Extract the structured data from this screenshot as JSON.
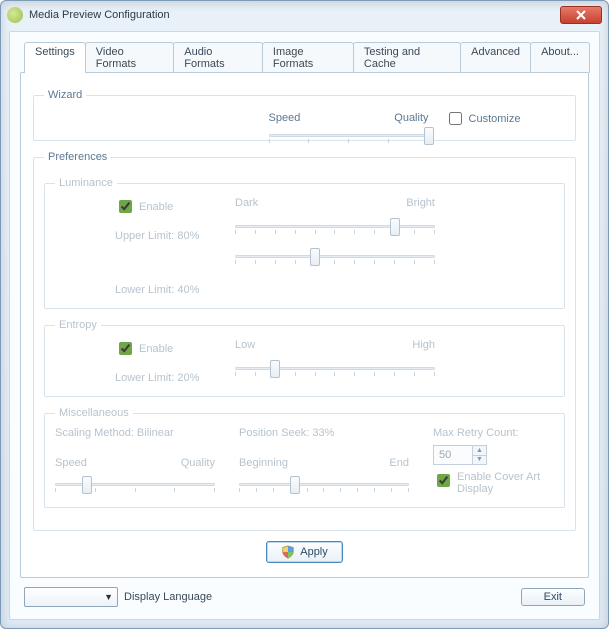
{
  "window": {
    "title": "Media Preview Configuration"
  },
  "tabs": [
    "Settings",
    "Video Formats",
    "Audio Formats",
    "Image Formats",
    "Testing and Cache",
    "Advanced",
    "About..."
  ],
  "active_tab": 0,
  "wizard": {
    "legend": "Wizard",
    "left_label": "Speed",
    "right_label": "Quality",
    "customize_label": "Customize",
    "customize_checked": false,
    "slider_percent": 100
  },
  "preferences": {
    "legend": "Preferences",
    "luminance": {
      "legend": "Luminance",
      "enable_label": "Enable",
      "enable_checked": true,
      "upper_limit_label": "Upper Limit: 80%",
      "upper_left": "Dark",
      "upper_right": "Bright",
      "upper_percent": 80,
      "lower_limit_label": "Lower Limit: 40%",
      "lower_percent": 40
    },
    "entropy": {
      "legend": "Entropy",
      "enable_label": "Enable",
      "enable_checked": true,
      "lower_limit_label": "Lower Limit: 20%",
      "left": "Low",
      "right": "High",
      "percent": 20
    },
    "misc": {
      "legend": "Miscellaneous",
      "scaling_label": "Scaling Method: Bilinear",
      "scaling_left": "Speed",
      "scaling_right": "Quality",
      "scaling_percent": 20,
      "position_label": "Position Seek: 33%",
      "position_left": "Beginning",
      "position_right": "End",
      "position_percent": 33,
      "retry_label": "Max Retry Count:",
      "retry_value": "50",
      "coverart_label": "Enable Cover Art Display",
      "coverart_checked": true
    }
  },
  "buttons": {
    "apply": "Apply",
    "exit": "Exit"
  },
  "footer": {
    "display_language_label": "Display Language"
  }
}
